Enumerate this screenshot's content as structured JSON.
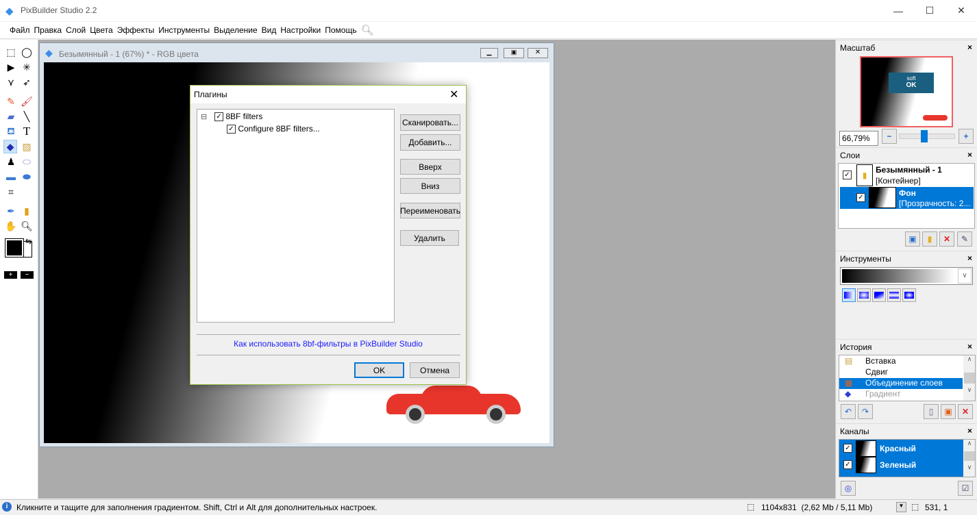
{
  "app": {
    "title": "PixBuilder Studio 2.2"
  },
  "menu": [
    "Файл",
    "Правка",
    "Слой",
    "Цвета",
    "Эффекты",
    "Инструменты",
    "Выделение",
    "Вид",
    "Настройки",
    "Помощь"
  ],
  "document": {
    "title": "Безымянный - 1 (67%) * - RGB цвета"
  },
  "dialog": {
    "title": "Плагины",
    "tree": [
      {
        "label": "8BF filters",
        "checked": true
      },
      {
        "label": "Configure 8BF filters...",
        "checked": true
      }
    ],
    "buttons": {
      "scan": "Сканировать...",
      "add": "Добавить...",
      "up": "Вверх",
      "down": "Вниз",
      "rename": "Переименовать",
      "delete": "Удалить",
      "ok": "OK",
      "cancel": "Отмена"
    },
    "link": "Как использовать 8bf-фильтры в PixBuilder Studio"
  },
  "panels": {
    "zoom": {
      "title": "Масштаб",
      "value": "66,79%",
      "slider": 0.45,
      "thumb_text": [
        "soft",
        "OK"
      ]
    },
    "layers": {
      "title": "Слои",
      "items": [
        {
          "name": "Безымянный - 1",
          "sub": "[Контейнер]"
        },
        {
          "name": "Фон",
          "sub": "[Прозрачность: 2..."
        }
      ]
    },
    "tools": {
      "title": "Инструменты"
    },
    "history": {
      "title": "История",
      "items": [
        "Вставка",
        "Сдвиг",
        "Объединение слоев",
        "Градиент"
      ]
    },
    "channels": {
      "title": "Каналы",
      "items": [
        "Красный",
        "Зеленый"
      ]
    }
  },
  "status": {
    "hint": "Кликните и тащите для заполнения градиентом. Shift, Ctrl и Alt для дополнительных настроек.",
    "size": "1104x831  (2,62 Mb / 5,11 Mb)",
    "coords": "531, 1"
  }
}
